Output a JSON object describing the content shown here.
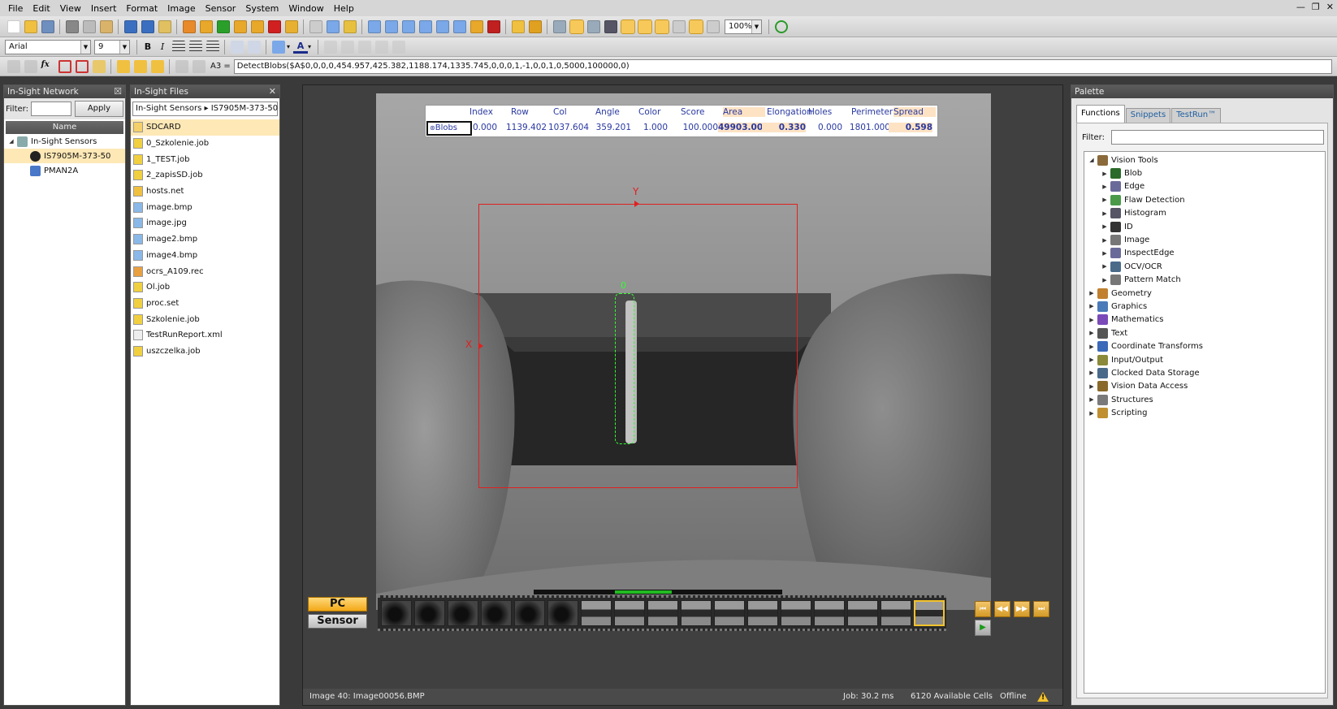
{
  "menu": {
    "items": [
      "File",
      "Edit",
      "View",
      "Insert",
      "Format",
      "Image",
      "Sensor",
      "System",
      "Window",
      "Help"
    ]
  },
  "window_controls": {
    "minimize": "—",
    "restore": "❐",
    "close": "✕"
  },
  "toolbar": {
    "zoom": "100%"
  },
  "format_bar": {
    "font": "Arial",
    "size": "9",
    "bold": "B",
    "italic": "I",
    "font_color": "A"
  },
  "formula": {
    "cell": "A3 =",
    "text": "DetectBlobs($A$0,0,0,0,454.957,425.382,1188.174,1335.745,0,0,0,1,-1,0,0,1,0,5000,100000,0)"
  },
  "network": {
    "title": "In-Sight Network",
    "filter_label": "Filter:",
    "filter_value": "",
    "apply": "Apply",
    "col_header": "Name",
    "root": "In-Sight Sensors",
    "sensors": [
      "IS7905M-373-50",
      "PMAN2A"
    ]
  },
  "files": {
    "title": "In-Sight Files",
    "path_root": "In-Sight Sensors",
    "path_sep": "▸",
    "path_sensor": "IS7905M-373-50",
    "items": [
      "SDCARD",
      "0_Szkolenie.job",
      "1_TEST.job",
      "2_zapisSD.job",
      "hosts.net",
      "image.bmp",
      "image.jpg",
      "image2.bmp",
      "image4.bmp",
      "ocrs_A109.rec",
      "Ol.job",
      "proc.set",
      "Szkolenie.job",
      "TestRunReport.xml",
      "uszczelka.job"
    ],
    "item_types": [
      "folder",
      "job",
      "job",
      "job",
      "net",
      "bmp",
      "bmp",
      "bmp",
      "bmp",
      "rec",
      "job",
      "set",
      "job",
      "xml",
      "job"
    ]
  },
  "results": {
    "headers": [
      "Index",
      "Row",
      "Col",
      "Angle",
      "Color",
      "Score",
      "Area",
      "Elongation",
      "Holes",
      "Perimeter",
      "Spread"
    ],
    "label": "Blobs",
    "values": [
      "0.000",
      "1139.402",
      "1037.604",
      "359.201",
      "1.000",
      "100.000",
      "49903.000",
      "0.330",
      "0.000",
      "1801.000",
      "0.598"
    ]
  },
  "overlay": {
    "y_label": "Y",
    "x_label": "X",
    "blob_label": "0"
  },
  "filmstrip": {
    "pc": "PC",
    "sensor": "Sensor",
    "frame_count": 17
  },
  "status": {
    "image": "Image 40: Image00056.BMP",
    "job": "Job: 30.2 ms",
    "cells": "6120 Available Cells",
    "mode": "Offline",
    "warn": "!"
  },
  "palette": {
    "title": "Palette",
    "tabs": [
      "Functions",
      "Snippets",
      "TestRun™"
    ],
    "filter_label": "Filter:",
    "filter_value": "",
    "vision_tools": "Vision Tools",
    "tools": [
      "Blob",
      "Edge",
      "Flaw Detection",
      "Histogram",
      "ID",
      "Image",
      "InspectEdge",
      "OCV/OCR",
      "Pattern Match"
    ],
    "categories": [
      "Geometry",
      "Graphics",
      "Mathematics",
      "Text",
      "Coordinate Transforms",
      "Input/Output",
      "Clocked Data Storage",
      "Vision Data Access",
      "Structures",
      "Scripting"
    ]
  },
  "colors": {
    "accent": "#f7c95a",
    "overlay_red": "#e02020",
    "blob_green": "#33ff33",
    "result_blue": "#2838a0"
  }
}
